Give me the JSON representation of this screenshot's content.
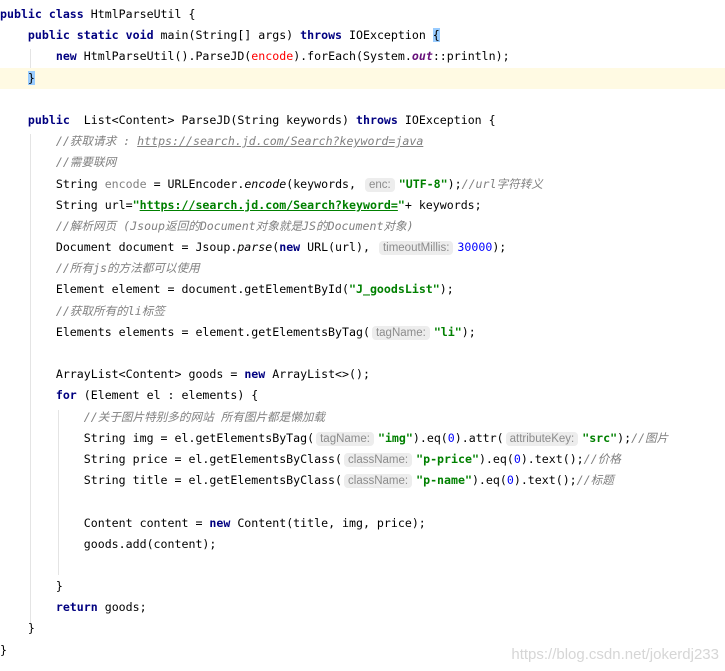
{
  "editor": {
    "current_line": 3,
    "brace_match_lines": [
      1,
      3
    ],
    "colors": {
      "keyword": "#000080",
      "string": "#008000",
      "comment": "#808080",
      "number": "#0000ff",
      "current_line": "#fffae3",
      "brace_match": "#99ccff"
    },
    "lines": [
      [
        [
          "public class ",
          "k"
        ],
        [
          "HtmlParseUtil {",
          ""
        ]
      ],
      [
        [
          "    ",
          ""
        ],
        [
          "public static void ",
          "k"
        ],
        [
          "main(String[] args) ",
          ""
        ],
        [
          "throws ",
          "k"
        ],
        [
          "IOException ",
          ""
        ],
        [
          "{",
          "b"
        ]
      ],
      [
        [
          "        ",
          ""
        ],
        [
          "new ",
          "k"
        ],
        [
          "HtmlParseUtil().ParseJD(",
          ""
        ],
        [
          "encode",
          "r"
        ],
        [
          ").forEach(System.",
          ""
        ],
        [
          "out",
          "f"
        ],
        [
          "::println);",
          ""
        ]
      ],
      [
        [
          "    ",
          ""
        ],
        [
          "}",
          "b"
        ]
      ],
      [],
      [
        [
          "    ",
          ""
        ],
        [
          "public  ",
          "k"
        ],
        [
          "List<Content> ParseJD(String keywords) ",
          ""
        ],
        [
          "throws ",
          "k"
        ],
        [
          "IOException {",
          ""
        ]
      ],
      [
        [
          "        ",
          ""
        ],
        [
          "//获取请求 : ",
          "c"
        ],
        [
          "https://search.jd.com/Search?keyword=java",
          "cu"
        ]
      ],
      [
        [
          "        ",
          ""
        ],
        [
          "//需要联网",
          "c"
        ]
      ],
      [
        [
          "        String ",
          ""
        ],
        [
          "encode",
          "g"
        ],
        [
          " = URLEncoder.",
          ""
        ],
        [
          "encode",
          "i"
        ],
        [
          "(keywords, ",
          ""
        ],
        [
          "enc:",
          "h"
        ],
        [
          "\"UTF-8\"",
          "s"
        ],
        [
          ");",
          ""
        ],
        [
          "//url字符转义",
          "c"
        ]
      ],
      [
        [
          "        String url=",
          ""
        ],
        [
          "\"",
          "s"
        ],
        [
          "https://search.jd.com/Search?keyword=",
          "su"
        ],
        [
          "\"",
          "s"
        ],
        [
          "+ keywords;",
          ""
        ]
      ],
      [
        [
          "        ",
          ""
        ],
        [
          "//解析网页 (Jsoup返回的Document对象就是JS的Document对象)",
          "c"
        ]
      ],
      [
        [
          "        Document document = Jsoup.",
          ""
        ],
        [
          "parse",
          "i"
        ],
        [
          "(",
          ""
        ],
        [
          "new ",
          "k"
        ],
        [
          "URL(url), ",
          ""
        ],
        [
          "timeoutMillis:",
          "h"
        ],
        [
          "30000",
          "n"
        ],
        [
          ");",
          ""
        ]
      ],
      [
        [
          "        ",
          ""
        ],
        [
          "//所有js的方法都可以使用",
          "c"
        ]
      ],
      [
        [
          "        Element element = document.getElementById(",
          ""
        ],
        [
          "\"J_goodsList\"",
          "s"
        ],
        [
          ");",
          ""
        ]
      ],
      [
        [
          "        ",
          ""
        ],
        [
          "//获取所有的li标签",
          "c"
        ]
      ],
      [
        [
          "        Elements elements = element.getElementsByTag(",
          ""
        ],
        [
          "tagName:",
          "h"
        ],
        [
          "\"li\"",
          "s"
        ],
        [
          ");",
          ""
        ]
      ],
      [],
      [
        [
          "        ArrayList<Content> goods = ",
          ""
        ],
        [
          "new ",
          "k"
        ],
        [
          "ArrayList<>();",
          ""
        ]
      ],
      [
        [
          "        ",
          ""
        ],
        [
          "for ",
          "k"
        ],
        [
          "(Element el : elements) {",
          ""
        ]
      ],
      [
        [
          "            ",
          ""
        ],
        [
          "//关于图片特别多的网站 所有图片都是懒加载",
          "c"
        ]
      ],
      [
        [
          "            String img = el.getElementsByTag(",
          ""
        ],
        [
          "tagName:",
          "h"
        ],
        [
          "\"img\"",
          "s"
        ],
        [
          ").eq(",
          ""
        ],
        [
          "0",
          "n"
        ],
        [
          ").attr(",
          ""
        ],
        [
          "attributeKey:",
          "h"
        ],
        [
          "\"src\"",
          "s"
        ],
        [
          ");",
          ""
        ],
        [
          "//图片",
          "c"
        ]
      ],
      [
        [
          "            String price = el.getElementsByClass(",
          ""
        ],
        [
          "className:",
          "h"
        ],
        [
          "\"p-price\"",
          "s"
        ],
        [
          ").eq(",
          ""
        ],
        [
          "0",
          "n"
        ],
        [
          ").text();",
          ""
        ],
        [
          "//价格",
          "c"
        ]
      ],
      [
        [
          "            String title = el.getElementsByClass(",
          ""
        ],
        [
          "className:",
          "h"
        ],
        [
          "\"p-name\"",
          "s"
        ],
        [
          ").eq(",
          ""
        ],
        [
          "0",
          "n"
        ],
        [
          ").text();",
          ""
        ],
        [
          "//标题",
          "c"
        ]
      ],
      [],
      [
        [
          "            Content content = ",
          ""
        ],
        [
          "new ",
          "k"
        ],
        [
          "Content(title, img, price);",
          ""
        ]
      ],
      [
        [
          "            goods.add(content);",
          ""
        ]
      ],
      [],
      [
        [
          "        }",
          ""
        ]
      ],
      [
        [
          "        ",
          ""
        ],
        [
          "return ",
          "k"
        ],
        [
          "goods;",
          ""
        ]
      ],
      [
        [
          "    }",
          ""
        ]
      ],
      [
        [
          "}",
          ""
        ]
      ]
    ]
  },
  "watermark": "https://blog.csdn.net/jokerdj233"
}
